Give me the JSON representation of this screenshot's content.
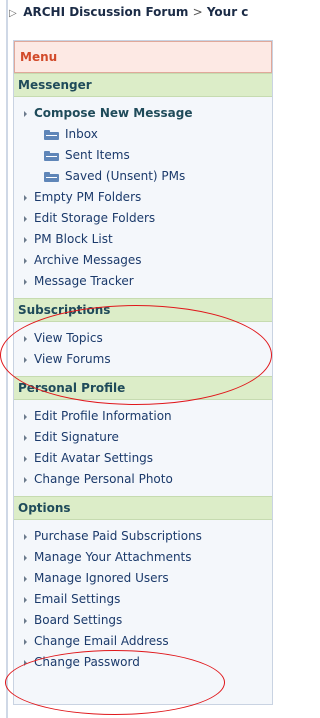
{
  "breadcrumb": {
    "root": "ARCHI Discussion Forum",
    "separator": ">",
    "current": "Your c"
  },
  "menu": {
    "title": "Menu"
  },
  "sections": {
    "messenger": {
      "title": "Messenger",
      "compose": "Compose New Message",
      "inbox": "Inbox",
      "sent": "Sent Items",
      "saved": "Saved (Unsent) PMs",
      "empty": "Empty PM Folders",
      "edit_storage": "Edit Storage Folders",
      "block_list": "PM Block List",
      "archive": "Archive Messages",
      "tracker": "Message Tracker"
    },
    "subscriptions": {
      "title": "Subscriptions",
      "view_topics": "View Topics",
      "view_forums": "View Forums"
    },
    "profile": {
      "title": "Personal Profile",
      "edit_info": "Edit Profile Information",
      "edit_signature": "Edit Signature",
      "edit_avatar": "Edit Avatar Settings",
      "change_photo": "Change Personal Photo"
    },
    "options": {
      "title": "Options",
      "paid_subs": "Purchase Paid Subscriptions",
      "attachments": "Manage Your Attachments",
      "ignored": "Manage Ignored Users",
      "email_settings": "Email Settings",
      "board_settings": "Board Settings",
      "change_email": "Change Email Address",
      "change_password": "Change Password"
    }
  },
  "colors": {
    "menu_header_bg": "#fde9e4",
    "menu_header_text": "#d24a2a",
    "section_header_bg": "#dcedc8",
    "annotation_red": "#e0171b"
  }
}
